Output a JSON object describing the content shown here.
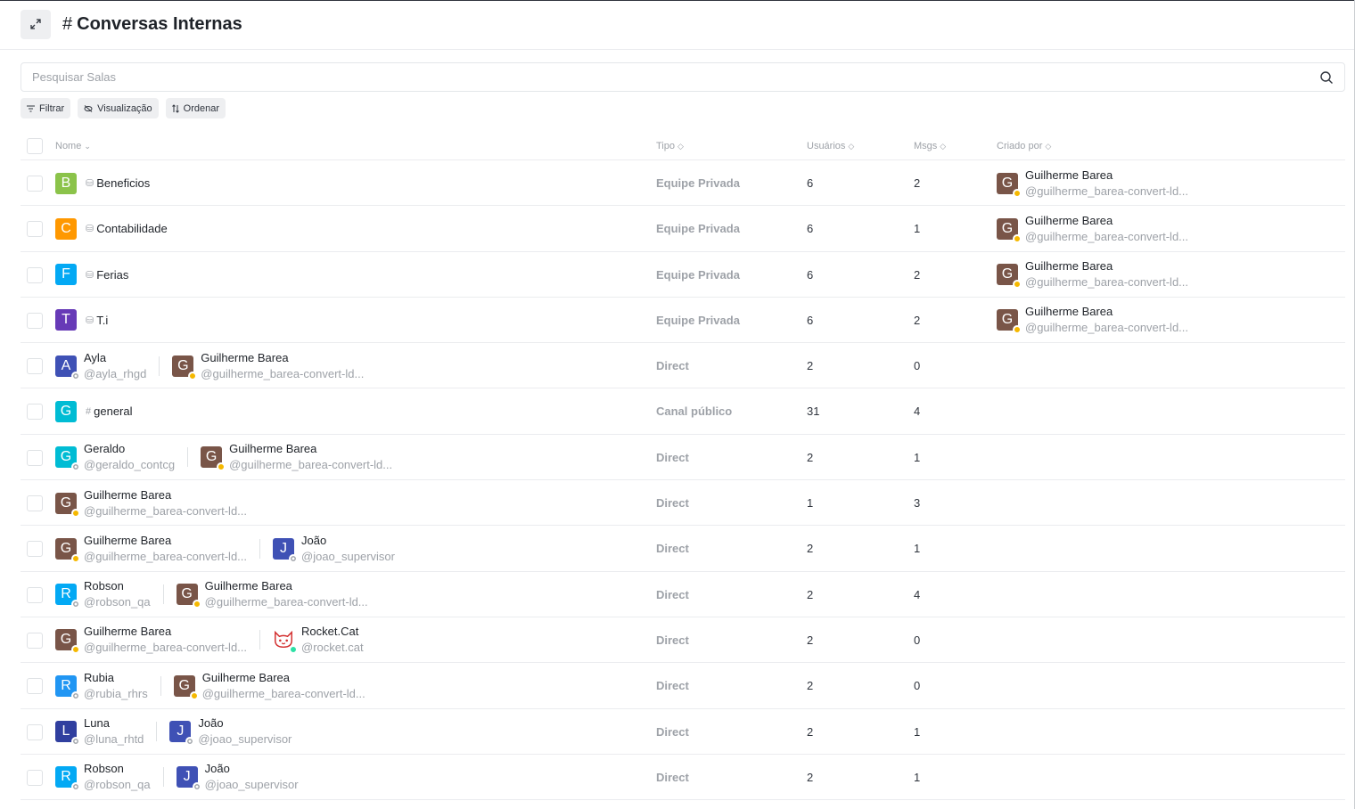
{
  "header": {
    "title_hash": "#",
    "title": "Conversas Internas"
  },
  "search": {
    "placeholder": "Pesquisar Salas"
  },
  "chips": [
    {
      "label": "Filtrar",
      "icon": "filter-icon"
    },
    {
      "label": "Visualização",
      "icon": "eye-off-icon"
    },
    {
      "label": "Ordenar",
      "icon": "sort-icon"
    }
  ],
  "columns": {
    "nome": "Nome",
    "tipo": "Tipo",
    "usuarios": "Usuários",
    "msgs": "Msgs",
    "criado_por": "Criado por"
  },
  "colors": {
    "away": "#f5b800",
    "online": "#2de0a5",
    "offline": "#9ea2a8",
    "guilherme": "#795548"
  },
  "rows": [
    {
      "kind": "room",
      "initial": "B",
      "color": "#8bc34a",
      "icon": "team-icon",
      "name": "Beneficios",
      "tipo": "Equipe Privada",
      "usuarios": "6",
      "msgs": "2",
      "creator": {
        "initial": "G",
        "name": "Guilherme Barea",
        "handle": "@guilherme_barea-convert-ld..."
      }
    },
    {
      "kind": "room",
      "initial": "C",
      "color": "#ff9800",
      "icon": "team-icon",
      "name": "Contabilidade",
      "tipo": "Equipe Privada",
      "usuarios": "6",
      "msgs": "1",
      "creator": {
        "initial": "G",
        "name": "Guilherme Barea",
        "handle": "@guilherme_barea-convert-ld..."
      }
    },
    {
      "kind": "room",
      "initial": "F",
      "color": "#03a9f4",
      "icon": "team-icon",
      "name": "Ferias",
      "tipo": "Equipe Privada",
      "usuarios": "6",
      "msgs": "2",
      "creator": {
        "initial": "G",
        "name": "Guilherme Barea",
        "handle": "@guilherme_barea-convert-ld..."
      }
    },
    {
      "kind": "room",
      "initial": "T",
      "color": "#673ab7",
      "icon": "team-icon",
      "name": "T.i",
      "tipo": "Equipe Privada",
      "usuarios": "6",
      "msgs": "2",
      "creator": {
        "initial": "G",
        "name": "Guilherme Barea",
        "handle": "@guilherme_barea-convert-ld..."
      }
    },
    {
      "kind": "direct",
      "users": [
        {
          "initial": "A",
          "color": "#3f51b5",
          "status": "off",
          "name": "Ayla",
          "handle": "@ayla_rhgd"
        },
        {
          "initial": "G",
          "color": "#795548",
          "status": "away",
          "name": "Guilherme Barea",
          "handle": "@guilherme_barea-convert-ld..."
        }
      ],
      "tipo": "Direct",
      "usuarios": "2",
      "msgs": "0"
    },
    {
      "kind": "room",
      "initial": "G",
      "color": "#00bcd4",
      "icon": "hash-icon",
      "name": "general",
      "tipo": "Canal público",
      "usuarios": "31",
      "msgs": "4"
    },
    {
      "kind": "direct",
      "users": [
        {
          "initial": "G",
          "color": "#00bcd4",
          "status": "off",
          "name": "Geraldo",
          "handle": "@geraldo_contcg"
        },
        {
          "initial": "G",
          "color": "#795548",
          "status": "away",
          "name": "Guilherme Barea",
          "handle": "@guilherme_barea-convert-ld..."
        }
      ],
      "tipo": "Direct",
      "usuarios": "2",
      "msgs": "1"
    },
    {
      "kind": "direct",
      "users": [
        {
          "initial": "G",
          "color": "#795548",
          "status": "away",
          "name": "Guilherme Barea",
          "handle": "@guilherme_barea-convert-ld..."
        }
      ],
      "tipo": "Direct",
      "usuarios": "1",
      "msgs": "3"
    },
    {
      "kind": "direct",
      "users": [
        {
          "initial": "G",
          "color": "#795548",
          "status": "away",
          "name": "Guilherme Barea",
          "handle": "@guilherme_barea-convert-ld..."
        },
        {
          "initial": "J",
          "color": "#3f51b5",
          "status": "off",
          "name": "João",
          "handle": "@joao_supervisor"
        }
      ],
      "tipo": "Direct",
      "usuarios": "2",
      "msgs": "1"
    },
    {
      "kind": "direct",
      "users": [
        {
          "initial": "R",
          "color": "#03a9f4",
          "status": "off",
          "name": "Robson",
          "handle": "@robson_qa"
        },
        {
          "initial": "G",
          "color": "#795548",
          "status": "away",
          "name": "Guilherme Barea",
          "handle": "@guilherme_barea-convert-ld..."
        }
      ],
      "tipo": "Direct",
      "usuarios": "2",
      "msgs": "4"
    },
    {
      "kind": "direct",
      "users": [
        {
          "initial": "G",
          "color": "#795548",
          "status": "away",
          "name": "Guilherme Barea",
          "handle": "@guilherme_barea-convert-ld..."
        },
        {
          "initial": "",
          "color": "cat",
          "status": "on",
          "name": "Rocket.Cat",
          "handle": "@rocket.cat"
        }
      ],
      "tipo": "Direct",
      "usuarios": "2",
      "msgs": "0"
    },
    {
      "kind": "direct",
      "users": [
        {
          "initial": "R",
          "color": "#2196f3",
          "status": "off",
          "name": "Rubia",
          "handle": "@rubia_rhrs"
        },
        {
          "initial": "G",
          "color": "#795548",
          "status": "away",
          "name": "Guilherme Barea",
          "handle": "@guilherme_barea-convert-ld..."
        }
      ],
      "tipo": "Direct",
      "usuarios": "2",
      "msgs": "0"
    },
    {
      "kind": "direct",
      "users": [
        {
          "initial": "L",
          "color": "#303f9f",
          "status": "off",
          "name": "Luna",
          "handle": "@luna_rhtd"
        },
        {
          "initial": "J",
          "color": "#3f51b5",
          "status": "off",
          "name": "João",
          "handle": "@joao_supervisor"
        }
      ],
      "tipo": "Direct",
      "usuarios": "2",
      "msgs": "1"
    },
    {
      "kind": "direct",
      "users": [
        {
          "initial": "R",
          "color": "#03a9f4",
          "status": "off",
          "name": "Robson",
          "handle": "@robson_qa"
        },
        {
          "initial": "J",
          "color": "#3f51b5",
          "status": "off",
          "name": "João",
          "handle": "@joao_supervisor"
        }
      ],
      "tipo": "Direct",
      "usuarios": "2",
      "msgs": "1"
    }
  ]
}
